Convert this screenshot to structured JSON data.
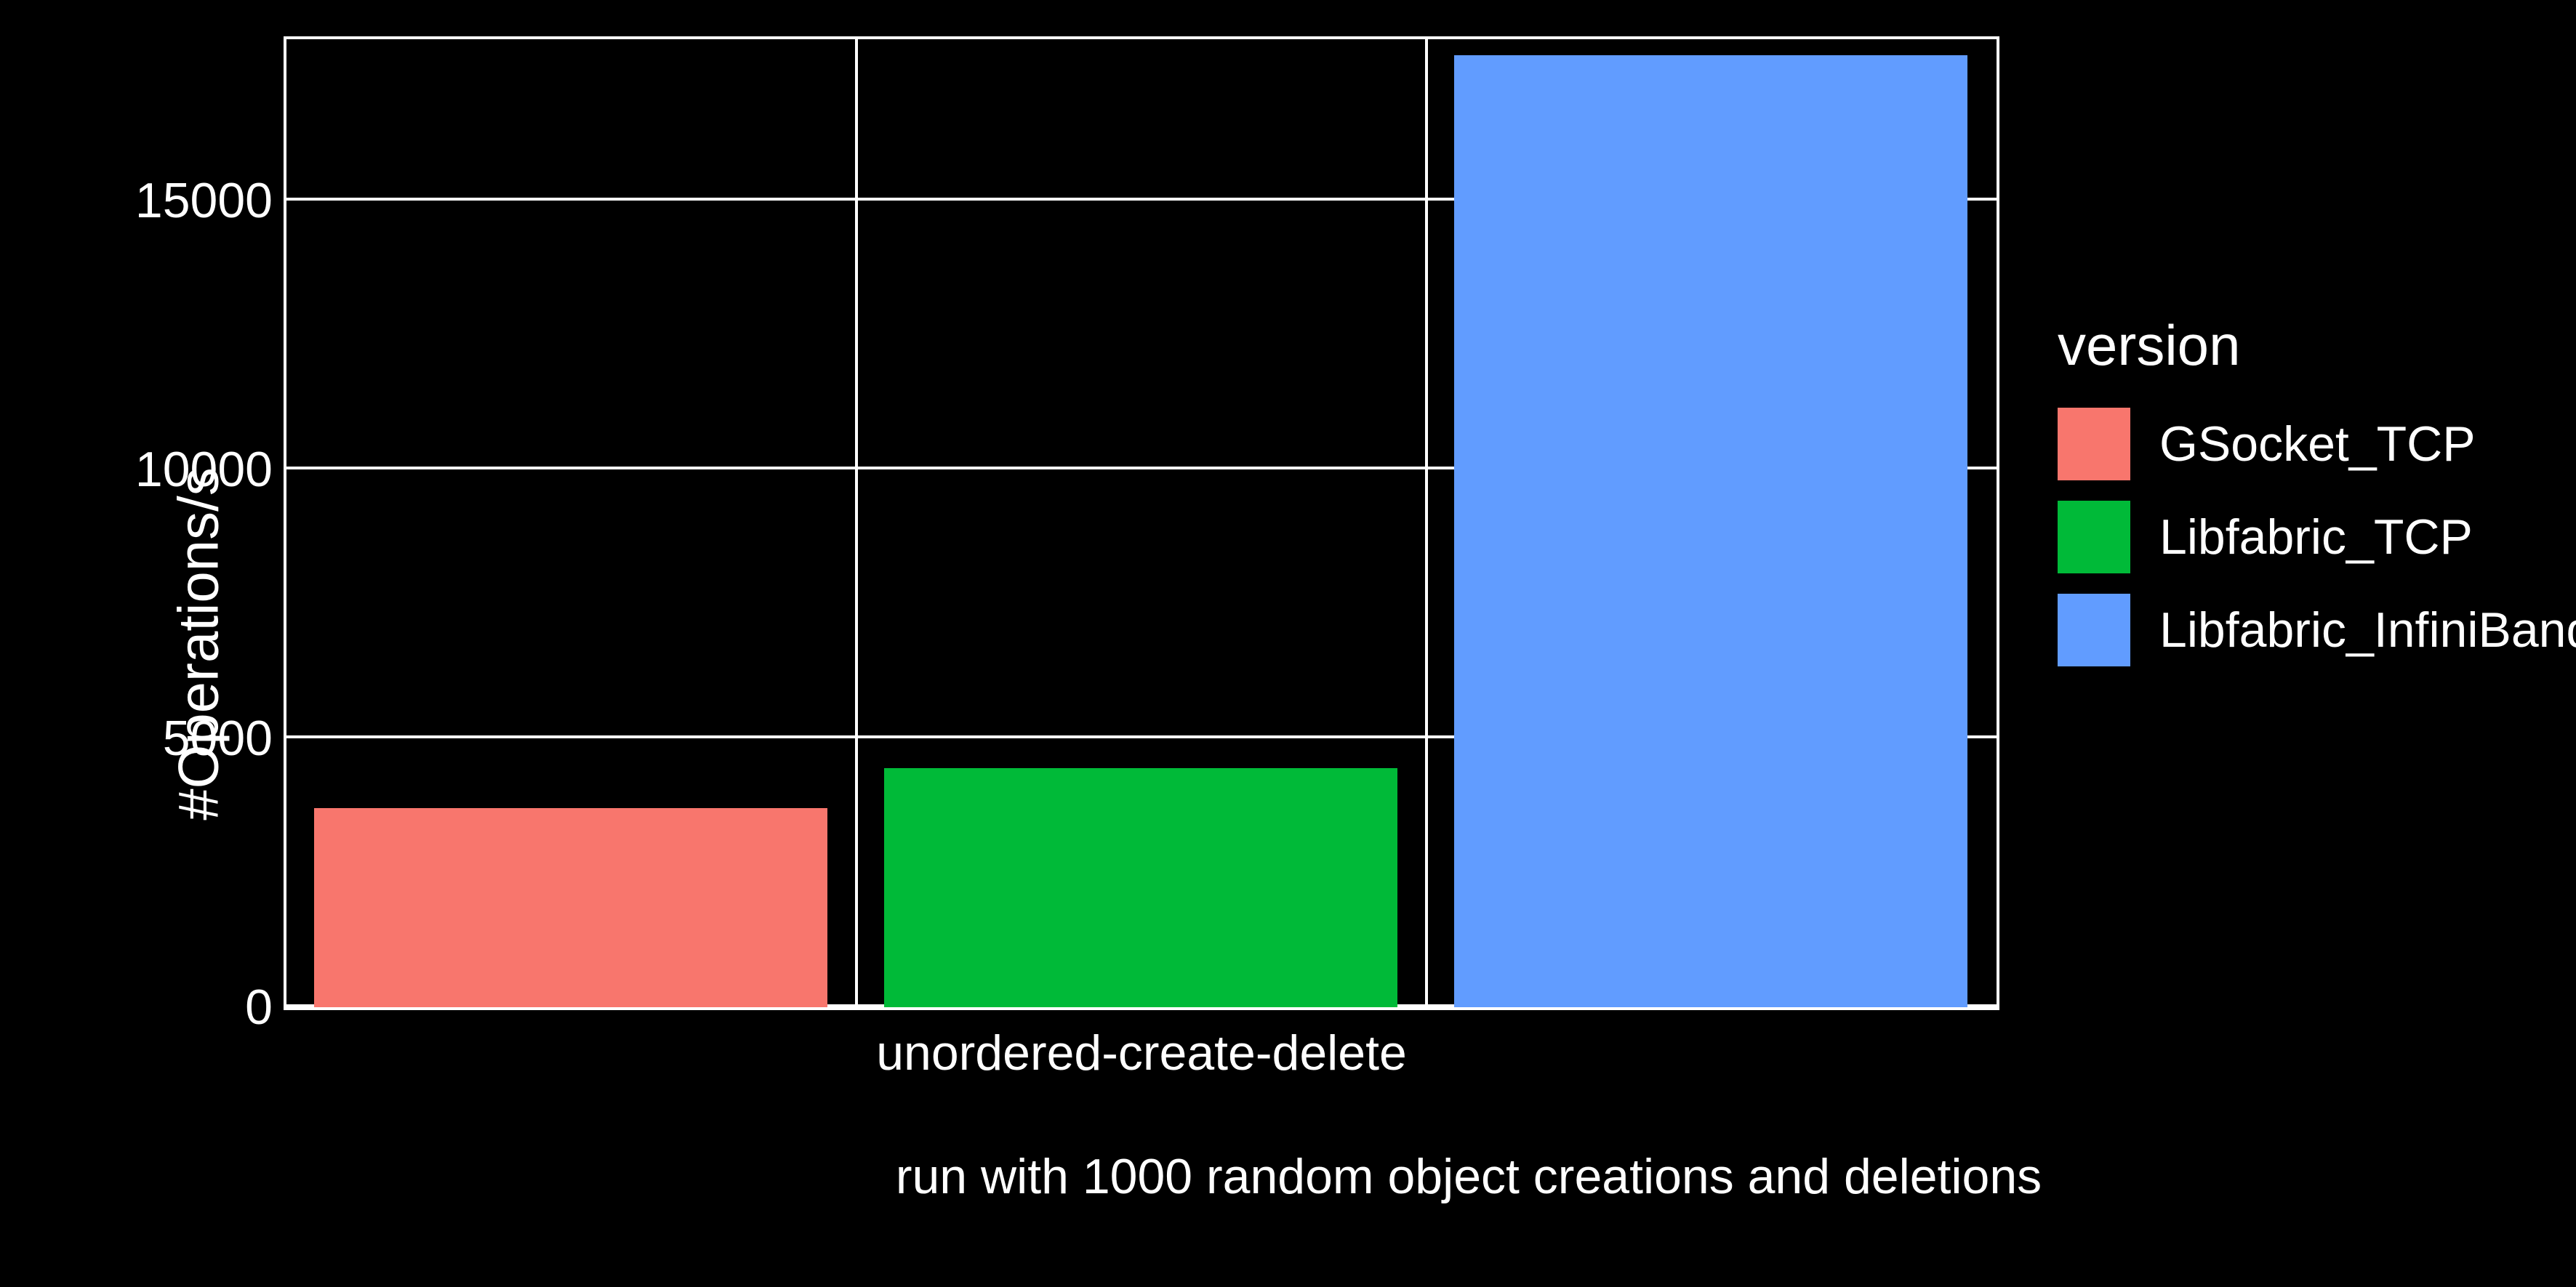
{
  "chart_data": {
    "type": "bar",
    "categories": [
      "unordered-create-delete"
    ],
    "series": [
      {
        "name": "GSocket_TCP",
        "color": "#f8766d",
        "values": [
          3700
        ]
      },
      {
        "name": "Libfabric_TCP",
        "color": "#00ba38",
        "values": [
          4450
        ]
      },
      {
        "name": "Libfabric_InfiniBand",
        "color": "#619cff",
        "values": [
          17700
        ]
      }
    ],
    "ylabel": "#Operations/s",
    "xlabel": "run with 1000 random object creations and deletions",
    "ylim": [
      0,
      18000
    ],
    "yticks": [
      0,
      5000,
      10000,
      15000
    ],
    "legend_title": "version"
  },
  "ytick_labels": {
    "t0": "0",
    "t1": "5000",
    "t2": "10000",
    "t3": "15000"
  }
}
